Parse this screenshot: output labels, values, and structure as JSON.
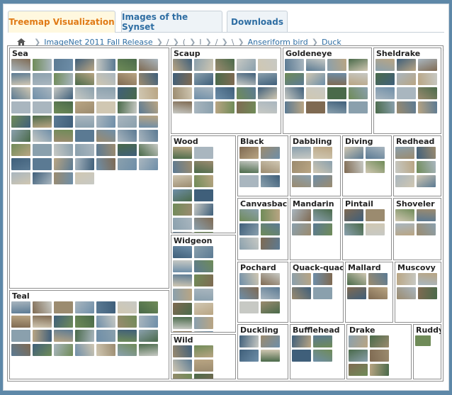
{
  "tabs": [
    {
      "label": "Treemap Visualization",
      "active": true
    },
    {
      "label": "Images of the Synset",
      "active": false
    },
    {
      "label": "Downloads",
      "active": false
    }
  ],
  "breadcrumb": {
    "root": "ImageNet 2011 Fall Release",
    "short_items": [
      "/",
      "(",
      "I",
      "/",
      "\\"
    ],
    "parent": "Anseriform bird",
    "current": "Duck"
  },
  "treemap_labels": {
    "sea": "Sea",
    "scaup": "Scaup",
    "goldeneye": "Goldeneye",
    "sheldrake": "Sheldrake",
    "wood": "Wood",
    "black": "Black",
    "dabbling": "Dabbling",
    "diving": "Diving",
    "redhead": "Redhead",
    "canvasback": "Canvasback",
    "mandarin": "Mandarin",
    "pintail": "Pintail",
    "shoveler": "Shoveler",
    "widgeon": "Widgeon",
    "pochard": "Pochard",
    "quack": "Quack-quack",
    "mallard": "Mallard",
    "muscovy": "Muscovy",
    "teal": "Teal",
    "wild": "Wild",
    "duckling": "Duckling",
    "bufflehead": "Bufflehead",
    "drake": "Drake",
    "ruddy": "Ruddy"
  },
  "thumbnail_palette": [
    "#5b7a93",
    "#8aa0ad",
    "#6f8b58",
    "#b9a583",
    "#3f5f7a",
    "#a9b6bf",
    "#7f6a52",
    "#c7c9c4",
    "#4a6a4a",
    "#9b8b6f",
    "#6e8ea8",
    "#d0c7b2"
  ],
  "colors": {
    "tab_active_text": "#e07a16",
    "link": "#2f6ea3",
    "page_bg": "#5e88a8"
  }
}
